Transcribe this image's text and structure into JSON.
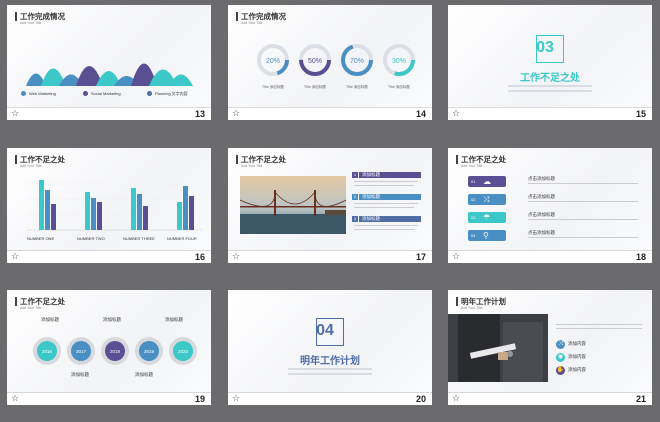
{
  "slides": [
    {
      "num": "13",
      "title": "工作完成情况",
      "sub": "Add Your Title",
      "legend": [
        "Web Marketing",
        "Social Marketing",
        "Planning 文字内容"
      ]
    },
    {
      "num": "14",
      "title": "工作完成情况",
      "sub": "Add Your Title",
      "percents": [
        "20%",
        "50%",
        "70%",
        "30%"
      ],
      "caption": "TItle 添加标题"
    },
    {
      "num": "15",
      "section": "03",
      "title": "工作不足之处"
    },
    {
      "num": "16",
      "title": "工作不足之处",
      "sub": "Add Your Title",
      "categories": [
        "NUMBER ONE",
        "NUMBER TWO",
        "NUMBER THREE",
        "NUMBER FOUR"
      ]
    },
    {
      "num": "17",
      "title": "工作不足之处",
      "sub": "Add Your Title",
      "items": [
        "添加标题",
        "添加标题",
        "添加标题"
      ],
      "indices": [
        "1",
        "2",
        "3"
      ]
    },
    {
      "num": "18",
      "title": "工作不足之处",
      "sub": "Add Your Title",
      "labels": [
        "点击添加标题",
        "点击添加标题",
        "点击添加标题",
        "点击添加标题"
      ],
      "tags": [
        "01",
        "02",
        "03",
        "04"
      ]
    },
    {
      "num": "19",
      "title": "工作不足之处",
      "sub": "Add Your Title",
      "years": [
        "2016",
        "2017",
        "2018",
        "2019",
        "2020"
      ],
      "labels": [
        "添加标题",
        "添加标题",
        "添加标题",
        "添加标题",
        "添加标题"
      ]
    },
    {
      "num": "20",
      "section": "04",
      "title": "明年工作计划"
    },
    {
      "num": "21",
      "title": "明年工作计划",
      "sub": "Add Your Title",
      "items": [
        "添加内容",
        "添加内容",
        "添加内容"
      ]
    }
  ],
  "colors": {
    "purple": "#5b4f93",
    "teal": "#3cc8c8",
    "blue": "#4a8fc4",
    "slate": "#4f6ea6"
  }
}
